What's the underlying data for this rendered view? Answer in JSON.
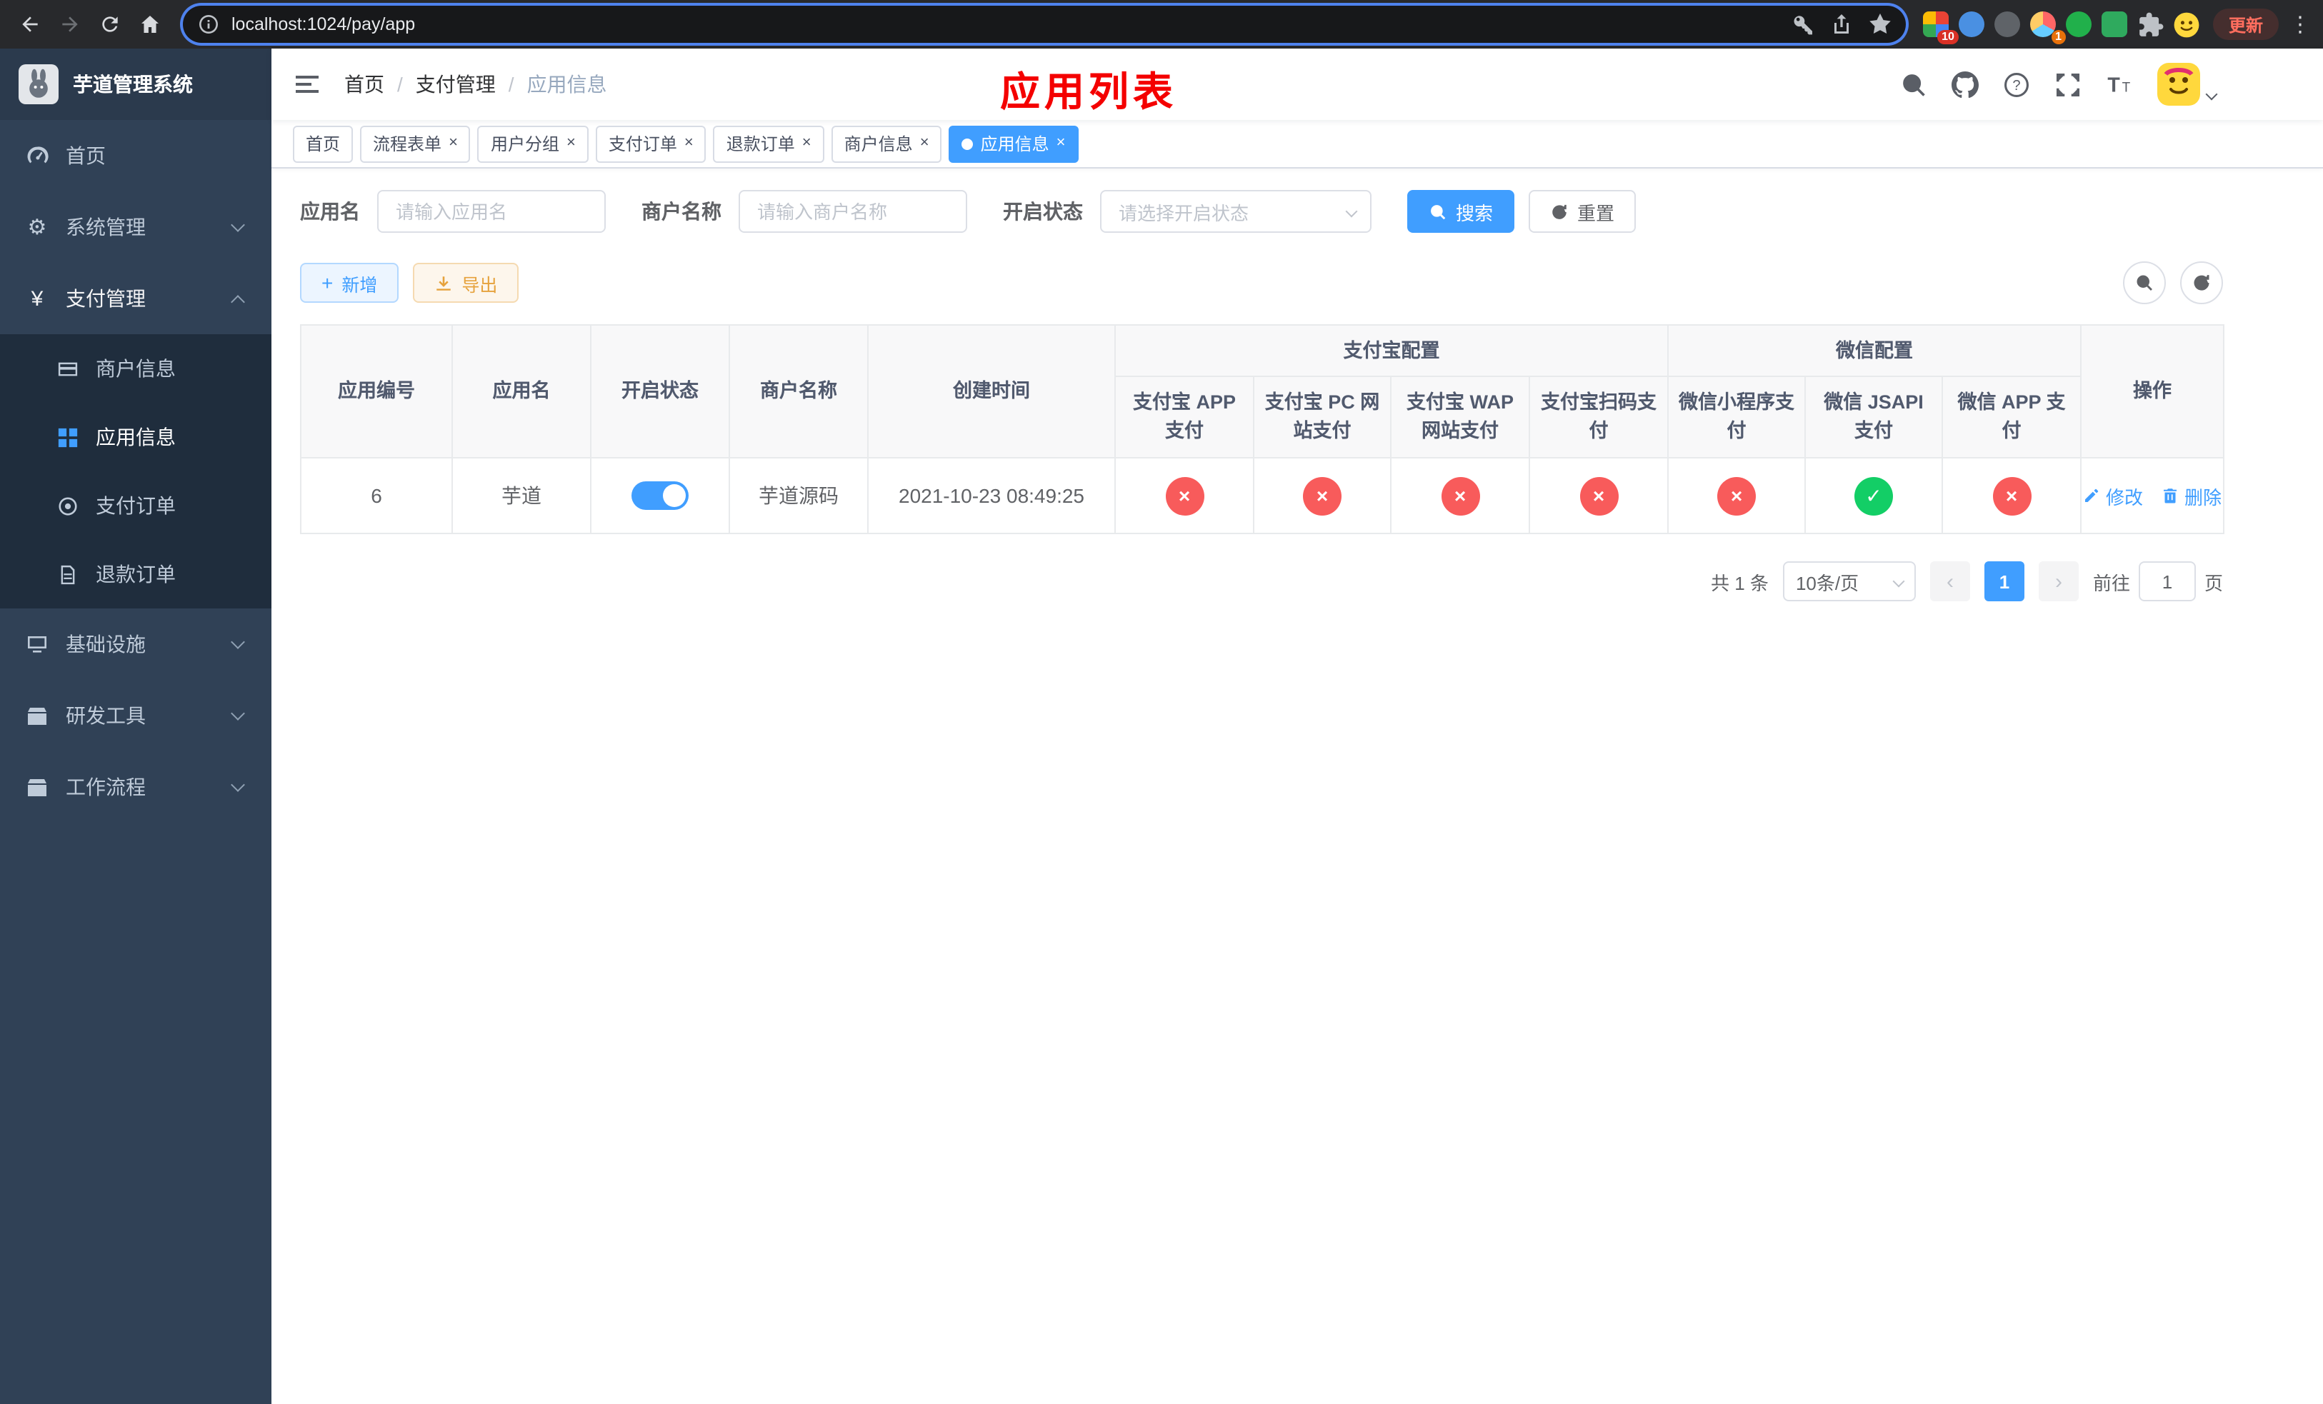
{
  "browser": {
    "url": "localhost:1024/pay/app",
    "update_label": "更新",
    "badges": {
      "ext1": "10",
      "ext4": "1"
    }
  },
  "sidebar": {
    "title": "芋道管理系统",
    "items": [
      {
        "label": "首页"
      },
      {
        "label": "系统管理"
      },
      {
        "label": "支付管理"
      },
      {
        "label": "商户信息"
      },
      {
        "label": "应用信息"
      },
      {
        "label": "支付订单"
      },
      {
        "label": "退款订单"
      },
      {
        "label": "基础设施"
      },
      {
        "label": "研发工具"
      },
      {
        "label": "工作流程"
      }
    ]
  },
  "navbar": {
    "breadcrumb": [
      {
        "label": "首页"
      },
      {
        "label": "支付管理"
      },
      {
        "label": "应用信息"
      }
    ],
    "separator": "/",
    "annotation": "应用列表"
  },
  "tabs": [
    {
      "label": "首页"
    },
    {
      "label": "流程表单"
    },
    {
      "label": "用户分组"
    },
    {
      "label": "支付订单"
    },
    {
      "label": "退款订单"
    },
    {
      "label": "商户信息"
    },
    {
      "label": "应用信息"
    }
  ],
  "filters": {
    "app_name_label": "应用名",
    "app_name_placeholder": "请输入应用名",
    "merchant_label": "商户名称",
    "merchant_placeholder": "请输入商户名称",
    "status_label": "开启状态",
    "status_placeholder": "请选择开启状态",
    "search_label": "搜索",
    "reset_label": "重置"
  },
  "toolbar": {
    "add_label": "新增",
    "export_label": "导出"
  },
  "table": {
    "col_id": "应用编号",
    "col_name": "应用名",
    "col_status": "开启状态",
    "col_merchant": "商户名称",
    "col_created": "创建时间",
    "group_alipay": "支付宝配置",
    "group_wechat": "微信配置",
    "col_alipay_app": "支付宝 APP 支付",
    "col_alipay_pc": "支付宝 PC 网站支付",
    "col_alipay_wap": "支付宝 WAP 网站支付",
    "col_alipay_qr": "支付宝扫码支付",
    "col_wx_mini": "微信小程序支付",
    "col_wx_jsapi": "微信 JSAPI 支付",
    "col_wx_app": "微信 APP 支付",
    "col_actions": "操作",
    "row": {
      "id": "6",
      "name": "芋道",
      "enabled": true,
      "merchant": "芋道源码",
      "created": "2021-10-23 08:49:25",
      "alipay_app": false,
      "alipay_pc": false,
      "alipay_wap": false,
      "alipay_qr": false,
      "wx_mini": false,
      "wx_jsapi": true,
      "wx_app": false,
      "edit_label": "修改",
      "delete_label": "删除"
    }
  },
  "pagination": {
    "total": "共 1 条",
    "page_size": "10条/页",
    "page": "1",
    "goto_label": "前往",
    "goto_value": "1",
    "page_unit": "页"
  },
  "icons": {
    "cross": "×",
    "check": "✓",
    "plus": "+",
    "yen": "¥",
    "gear": "⚙",
    "kebab": "⋮"
  },
  "colors": {
    "primary": "#409eff",
    "success": "#13ce66",
    "danger": "#f85b5b",
    "annotation": "#f40000",
    "sidebar_bg": "#304156",
    "submenu_bg": "#1f2d3d"
  }
}
